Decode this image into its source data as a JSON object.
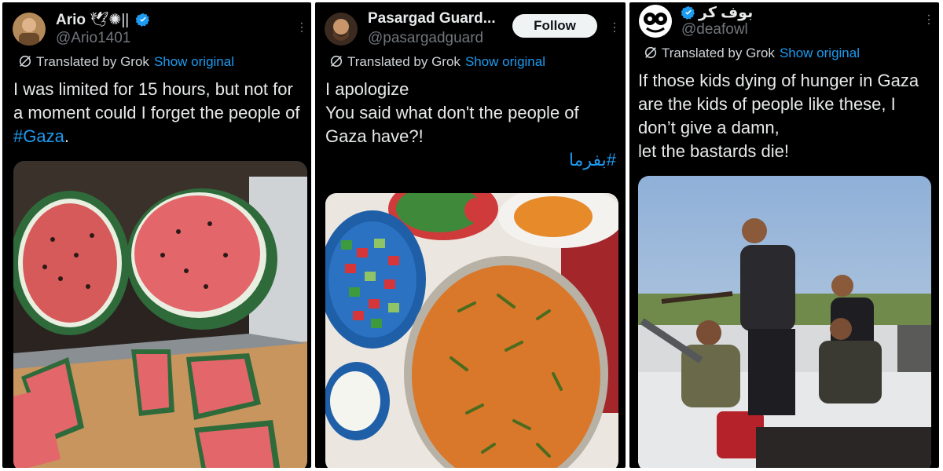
{
  "posts": [
    {
      "name": "Ario",
      "name_suffix": "🕊✺||",
      "handle": "@Ario1401",
      "translated_label": "Translated by Grok",
      "show_original": "Show original",
      "text_before": "I was limited for 15 hours, but not for a moment could I forget the people of ",
      "hashtag": "#Gaza",
      "text_after": ".",
      "media_icon": "watermelon-photo"
    },
    {
      "name": "Pasargad Guard...",
      "handle": "@pasargadguard",
      "follow_label": "Follow",
      "translated_label": "Translated by Grok",
      "show_original": "Show original",
      "text": "I apologize\nYou said what don't the people of Gaza have?!",
      "hashtag": "#بفرما",
      "media_icon": "persian-rice-feast-photo"
    },
    {
      "name": "بوف کر",
      "handle": "@deafowl",
      "translated_label": "Translated by Grok",
      "show_original": "Show original",
      "text": "If those kids dying of hunger in Gaza are the kids of people like these, I don’t give a damn,\nlet the bastards die!",
      "media_icon": "armed-men-truck-photo"
    }
  ],
  "colors": {
    "background": "#000000",
    "text": "#e7e9ea",
    "secondary": "#71767b",
    "link": "#1d9bf0",
    "verified": "#1d9bf0"
  }
}
